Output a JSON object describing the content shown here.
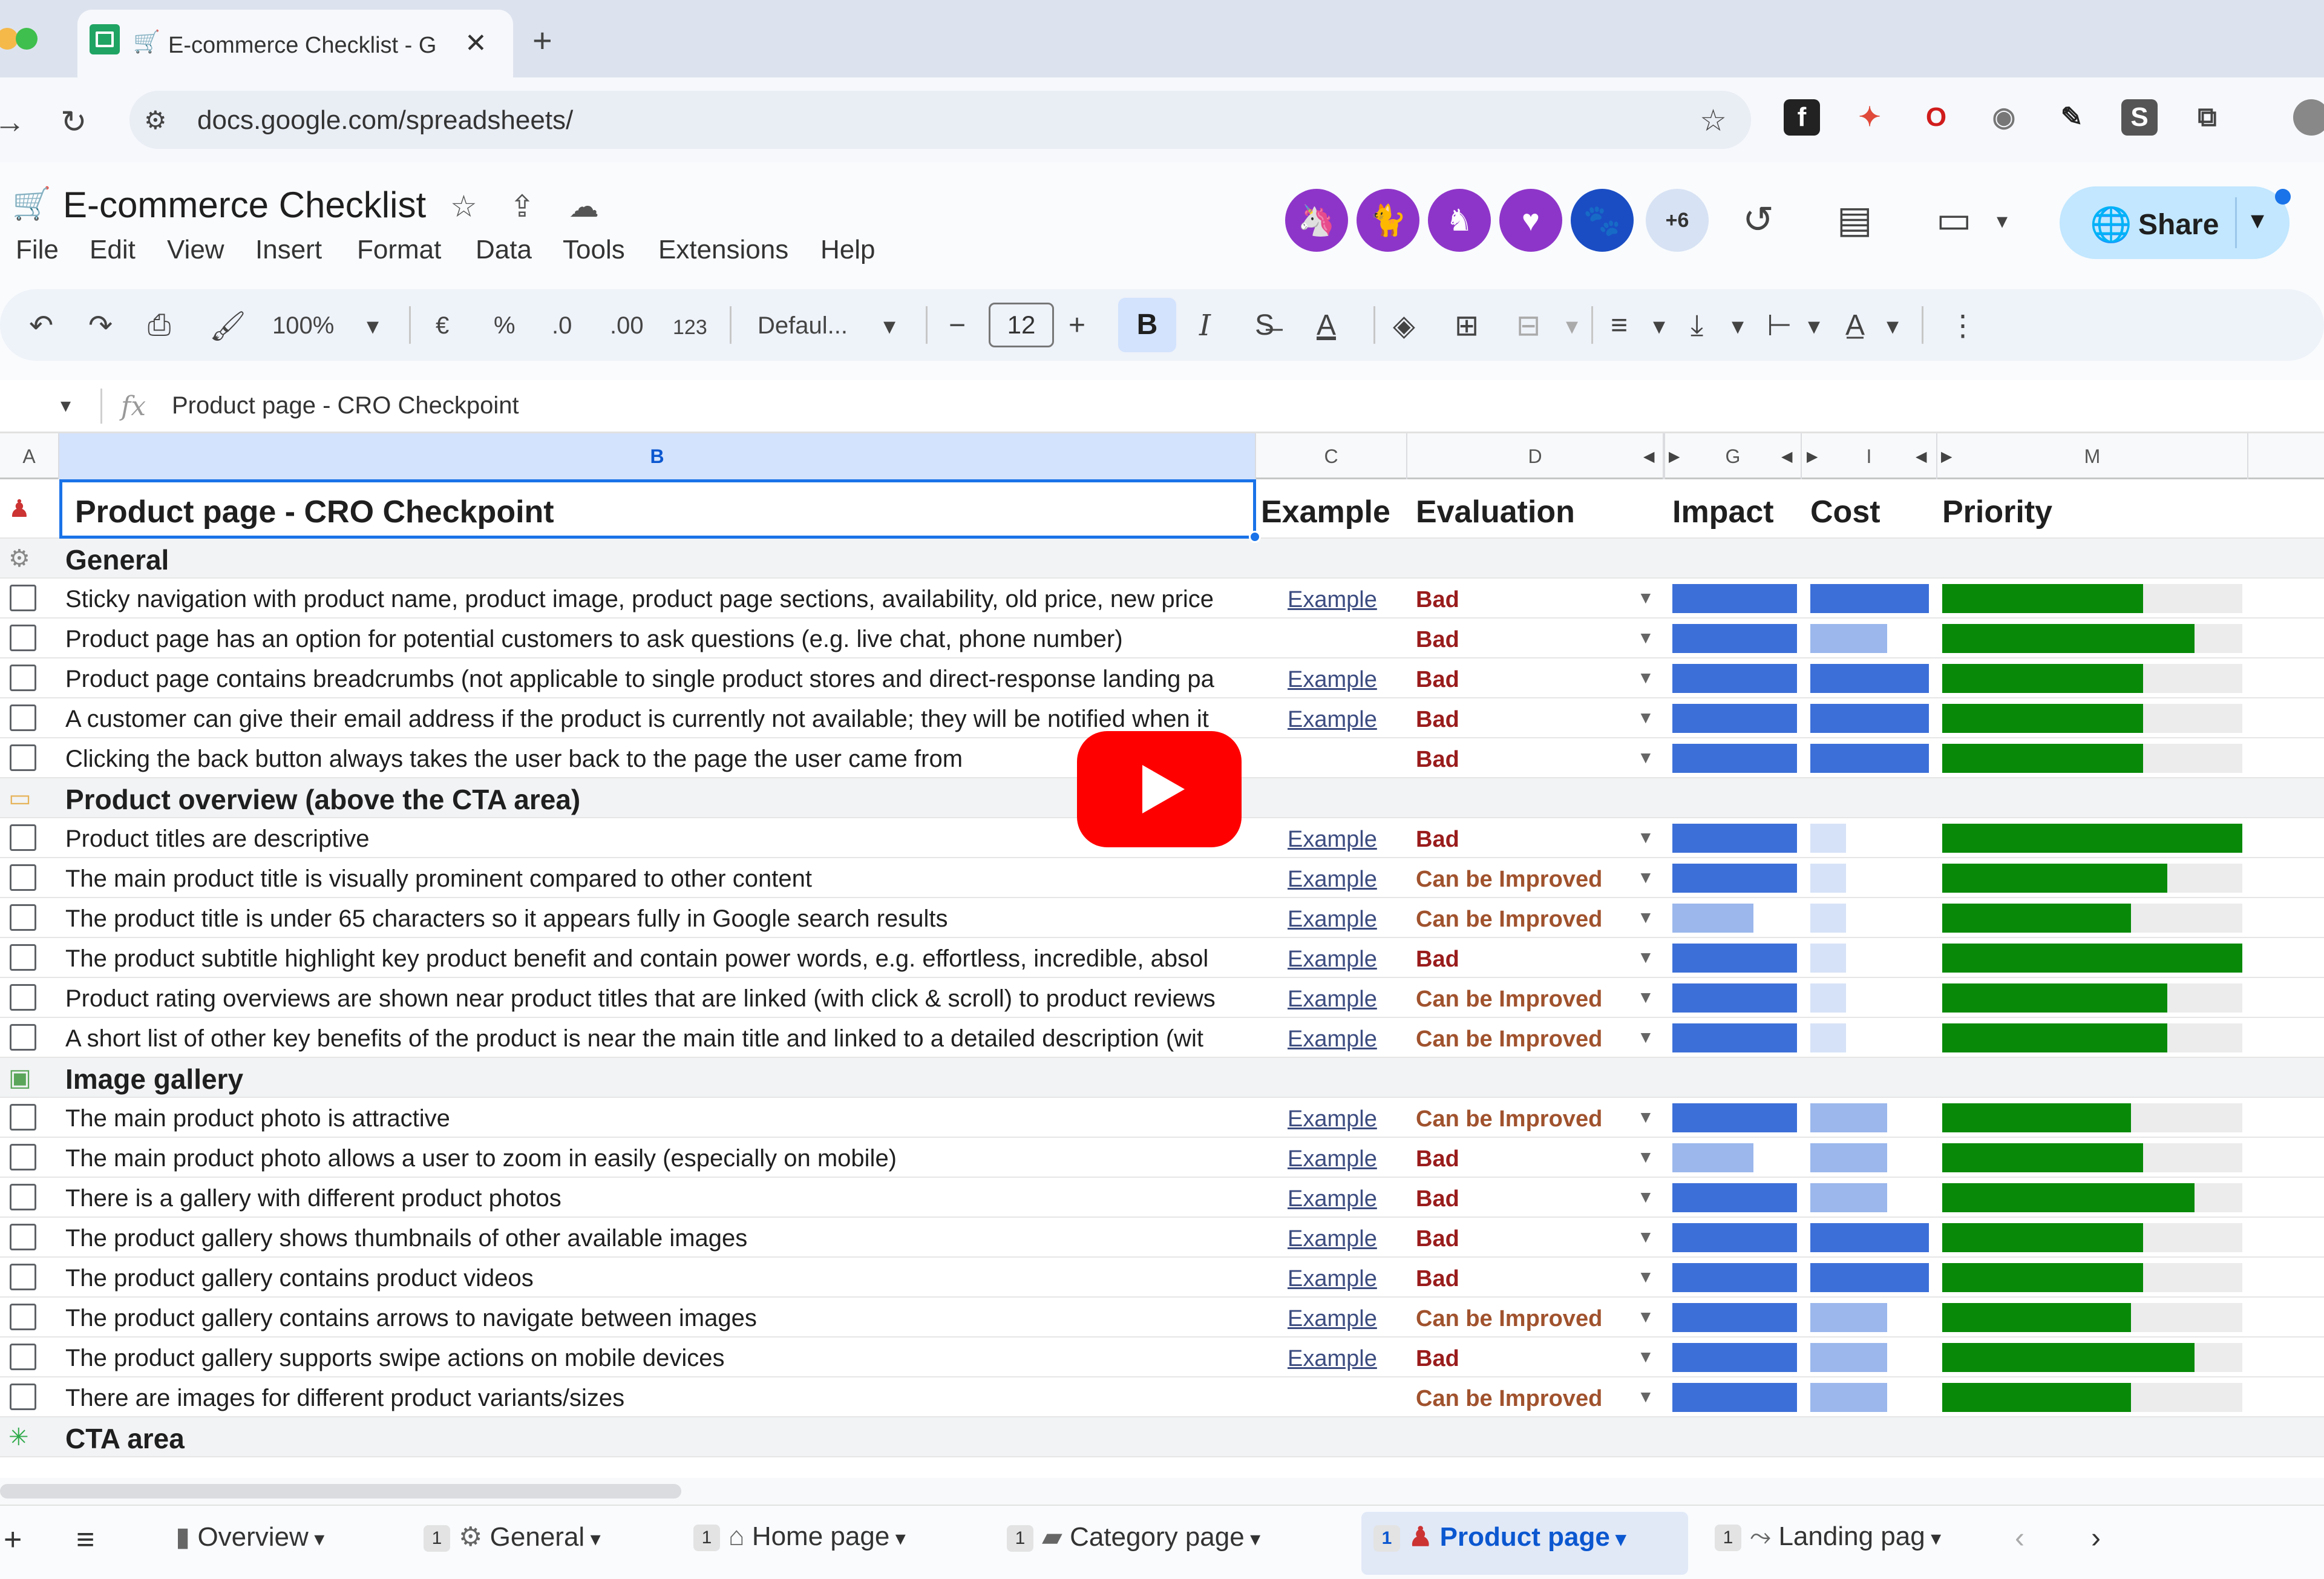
{
  "browser": {
    "tab_title": "E-commerce Checklist - G",
    "url": "docs.google.com/spreadsheets/"
  },
  "sheets": {
    "doc_title": "E-commerce Checklist",
    "menu": [
      "File",
      "Edit",
      "View",
      "Insert",
      "Format",
      "Data",
      "Tools",
      "Extensions",
      "Help"
    ],
    "collaborators_more": "+6",
    "share_label": "Share"
  },
  "toolbar": {
    "zoom": "100%",
    "currency": "€",
    "percent": "%",
    "dec_decrease": ".0",
    "dec_increase": ".00",
    "number_format": "123",
    "font": "Defaul...",
    "font_size": "12",
    "bold": "B",
    "italic": "I"
  },
  "formula_bar": {
    "content": "Product page - CRO Checkpoint"
  },
  "columns": [
    "A",
    "B",
    "C",
    "D",
    "G",
    "I",
    "M"
  ],
  "header_row": {
    "b": "Product page - CRO Checkpoint",
    "c": "Example",
    "d": "Evaluation",
    "impact": "Impact",
    "cost": "Cost",
    "priority": "Priority"
  },
  "rows": [
    {
      "type": "section",
      "label": "General",
      "icon": "gear-icon"
    },
    {
      "type": "item",
      "text": "Sticky navigation with product name, product image, product page sections, availability, old price, new price",
      "example": "Example",
      "evaluation": "Bad",
      "impact": 1.0,
      "cost": 1.0,
      "priority": 0.67
    },
    {
      "type": "item",
      "text": "Product page has an option for potential customers to ask questions (e.g. live chat, phone number)",
      "example": "",
      "evaluation": "Bad",
      "impact": 1.0,
      "cost": 0.65,
      "priority": 0.84
    },
    {
      "type": "item",
      "text": "Product page contains breadcrumbs (not applicable to single product stores and direct-response landing pa",
      "example": "Example",
      "evaluation": "Bad",
      "impact": 1.0,
      "cost": 1.0,
      "priority": 0.67
    },
    {
      "type": "item",
      "text": "A customer can give their email address if the product is currently not available; they will be notified when it",
      "example": "Example",
      "evaluation": "Bad",
      "impact": 1.0,
      "cost": 1.0,
      "priority": 0.67
    },
    {
      "type": "item",
      "text": "Clicking the back button always takes the user back to the page the user came from",
      "example": "",
      "evaluation": "Bad",
      "impact": 1.0,
      "cost": 1.0,
      "priority": 0.67
    },
    {
      "type": "section",
      "label": "Product overview (above the CTA area)",
      "icon": "label-icon"
    },
    {
      "type": "item",
      "text": "Product titles are descriptive",
      "example": "Example",
      "evaluation": "Bad",
      "impact": 1.0,
      "cost": 0.3,
      "priority": 1.0
    },
    {
      "type": "item",
      "text": "The main product title is visually prominent compared to other content",
      "example": "Example",
      "evaluation": "Can be Improved",
      "impact": 1.0,
      "cost": 0.3,
      "priority": 0.75
    },
    {
      "type": "item",
      "text": "The product title is under 65 characters so it appears fully in Google search results",
      "example": "Example",
      "evaluation": "Can be Improved",
      "impact": 0.65,
      "cost": 0.3,
      "priority": 0.63
    },
    {
      "type": "item",
      "text": "The product subtitle highlight key product benefit and contain power words, e.g. effortless, incredible, absol",
      "example": "Example",
      "evaluation": "Bad",
      "impact": 1.0,
      "cost": 0.3,
      "priority": 1.0
    },
    {
      "type": "item",
      "text": "Product rating overviews are shown near product titles that are linked (with click & scroll) to product reviews",
      "example": "Example",
      "evaluation": "Can be Improved",
      "impact": 1.0,
      "cost": 0.3,
      "priority": 0.75
    },
    {
      "type": "item",
      "text": "A short list of other key benefits of the product is near the main title and linked to a detailed description (wit",
      "example": "Example",
      "evaluation": "Can be Improved",
      "impact": 1.0,
      "cost": 0.3,
      "priority": 0.75
    },
    {
      "type": "section",
      "label": "Image gallery",
      "icon": "image-icon"
    },
    {
      "type": "item",
      "text": "The main product photo is attractive",
      "example": "Example",
      "evaluation": "Can be Improved",
      "impact": 1.0,
      "cost": 0.65,
      "priority": 0.63
    },
    {
      "type": "item",
      "text": "The main product photo allows a user to zoom in easily (especially on mobile)",
      "example": "Example",
      "evaluation": "Bad",
      "impact": 0.65,
      "cost": 0.65,
      "priority": 0.67
    },
    {
      "type": "item",
      "text": "There is a gallery with different product photos",
      "example": "Example",
      "evaluation": "Bad",
      "impact": 1.0,
      "cost": 0.65,
      "priority": 0.84
    },
    {
      "type": "item",
      "text": "The product gallery shows thumbnails of other available images",
      "example": "Example",
      "evaluation": "Bad",
      "impact": 1.0,
      "cost": 1.0,
      "priority": 0.67
    },
    {
      "type": "item",
      "text": "The product gallery contains product videos",
      "example": "Example",
      "evaluation": "Bad",
      "impact": 1.0,
      "cost": 1.0,
      "priority": 0.67
    },
    {
      "type": "item",
      "text": "The product gallery contains arrows to navigate between images",
      "example": "Example",
      "evaluation": "Can be Improved",
      "impact": 1.0,
      "cost": 0.65,
      "priority": 0.63
    },
    {
      "type": "item",
      "text": "The product gallery supports swipe actions on mobile devices",
      "example": "Example",
      "evaluation": "Bad",
      "impact": 1.0,
      "cost": 0.65,
      "priority": 0.84
    },
    {
      "type": "item",
      "text": "There are images for different product variants/sizes",
      "example": "",
      "evaluation": "Can be Improved",
      "impact": 1.0,
      "cost": 0.65,
      "priority": 0.63
    },
    {
      "type": "section",
      "label": "CTA area",
      "icon": "sparkle-icon"
    }
  ],
  "sheet_tabs": [
    {
      "label": "Overview",
      "badge": "",
      "icon": "chart-icon"
    },
    {
      "label": "General",
      "badge": "1",
      "icon": "gear-icon"
    },
    {
      "label": "Home page",
      "badge": "1",
      "icon": "home-icon"
    },
    {
      "label": "Category page",
      "badge": "1",
      "icon": "folder-icon"
    },
    {
      "label": "Product page",
      "badge": "1",
      "icon": "product-icon",
      "active": true
    },
    {
      "label": "Landing pag",
      "badge": "1",
      "icon": "landing-icon"
    }
  ],
  "colors": {
    "impact": "#3c6fd8",
    "priority": "#088a08",
    "bad": "#9a1c1c",
    "improve": "#a0522d",
    "youtube": "#ff0000"
  }
}
